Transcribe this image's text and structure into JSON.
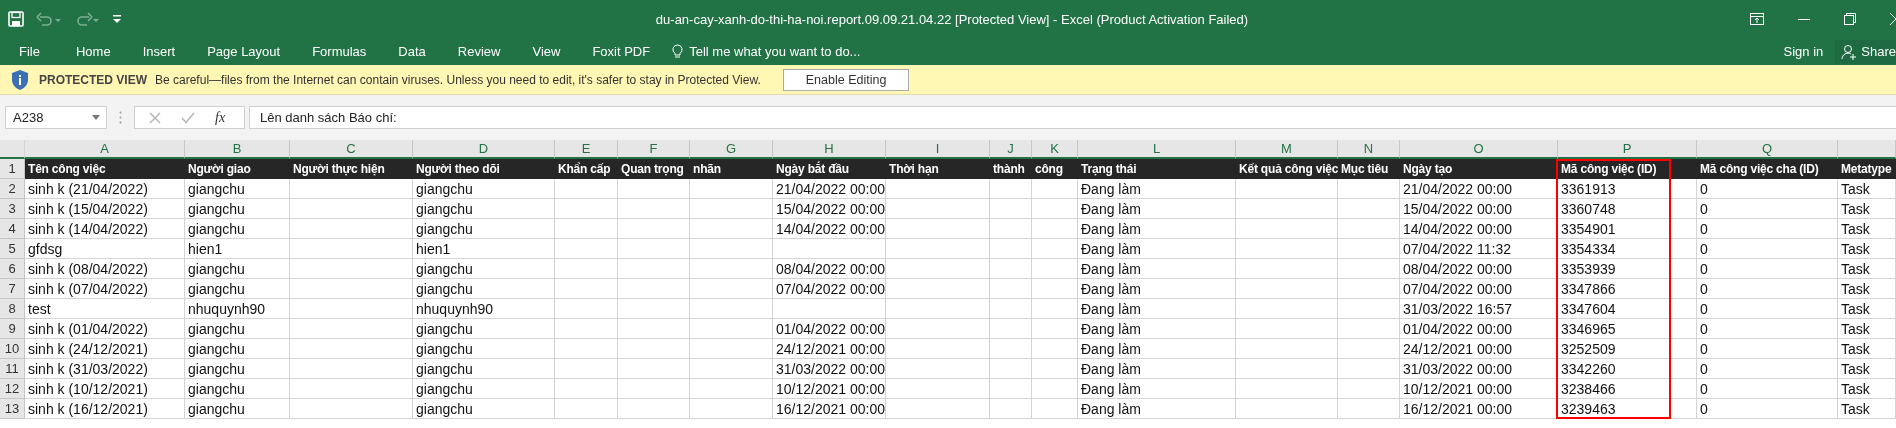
{
  "window": {
    "title": "du-an-cay-xanh-do-thi-ha-noi.report.09.09.21.04.22  [Protected View] - Excel (Product Activation Failed)",
    "quick_access": [
      {
        "kind": "save"
      },
      {
        "kind": "undo",
        "disabled": true
      },
      {
        "kind": "redo",
        "disabled": true
      },
      {
        "kind": "customize"
      }
    ],
    "controls": [
      {
        "kind": "ribbon-display"
      },
      {
        "kind": "minimize"
      },
      {
        "kind": "restore"
      },
      {
        "kind": "close"
      }
    ]
  },
  "ribbon": {
    "tabs": [
      {
        "label": "File"
      },
      {
        "label": "Home"
      },
      {
        "label": "Insert"
      },
      {
        "label": "Page Layout"
      },
      {
        "label": "Formulas"
      },
      {
        "label": "Data"
      },
      {
        "label": "Review"
      },
      {
        "label": "View"
      },
      {
        "label": "Foxit PDF"
      }
    ],
    "tell_me": "Tell me what you want to do...",
    "sign_in": "Sign in",
    "share": "Share"
  },
  "message_bar": {
    "title": "PROTECTED VIEW",
    "text": "Be careful—files from the Internet can contain viruses. Unless you need to edit, it's safer to stay in Protected View.",
    "button": "Enable Editing"
  },
  "formula_bar": {
    "name_box": "A238",
    "fx": "fx",
    "value": "Lên danh sách Báo chí:"
  },
  "sheet": {
    "columns": [
      {
        "letter": "A",
        "header": "Tên công việc",
        "highlighted": false
      },
      {
        "letter": "B",
        "header": "Người giao",
        "highlighted": false
      },
      {
        "letter": "C",
        "header": "Người thực hiện",
        "highlighted": false
      },
      {
        "letter": "D",
        "header": "Người theo dõi",
        "highlighted": false
      },
      {
        "letter": "E",
        "header": "Khẩn cấp",
        "highlighted": false
      },
      {
        "letter": "F",
        "header": "Quan trọng",
        "highlighted": false
      },
      {
        "letter": "G",
        "header": "nhãn",
        "highlighted": false
      },
      {
        "letter": "H",
        "header": "Ngày bắt đầu",
        "highlighted": false
      },
      {
        "letter": "I",
        "header": "Thời hạn",
        "highlighted": false
      },
      {
        "letter": "J",
        "header": "thành",
        "highlighted": false
      },
      {
        "letter": "K",
        "header": "công",
        "highlighted": false
      },
      {
        "letter": "L",
        "header": "Trạng thái",
        "highlighted": false
      },
      {
        "letter": "M",
        "header": "Kết quả công việc",
        "highlighted": false
      },
      {
        "letter": "N",
        "header": "Mục tiêu",
        "highlighted": false
      },
      {
        "letter": "O",
        "header": "Ngày tạo",
        "highlighted": false
      },
      {
        "letter": "P",
        "header": "Mã công việc (ID)",
        "highlighted": true
      },
      {
        "letter": "Q",
        "header": "Mã công việc cha (ID)",
        "highlighted": false
      },
      {
        "header": "Metatype",
        "highlighted": false
      }
    ],
    "header_row_number": "1",
    "rows": [
      {
        "number": "2",
        "cells": [
          "sinh k (21/04/2022)",
          "giangchu",
          null,
          "giangchu",
          null,
          null,
          null,
          "21/04/2022 00:00",
          null,
          null,
          null,
          "Đang làm",
          null,
          null,
          "21/04/2022 00:00",
          "3361913",
          "0",
          "Task"
        ]
      },
      {
        "number": "3",
        "cells": [
          "sinh k (15/04/2022)",
          "giangchu",
          null,
          "giangchu",
          null,
          null,
          null,
          "15/04/2022 00:00",
          null,
          null,
          null,
          "Đang làm",
          null,
          null,
          "15/04/2022 00:00",
          "3360748",
          "0",
          "Task"
        ]
      },
      {
        "number": "4",
        "cells": [
          "sinh k (14/04/2022)",
          "giangchu",
          null,
          "giangchu",
          null,
          null,
          null,
          "14/04/2022 00:00",
          null,
          null,
          null,
          "Đang làm",
          null,
          null,
          "14/04/2022 00:00",
          "3354901",
          "0",
          "Task"
        ]
      },
      {
        "number": "5",
        "cells": [
          "gfdsg",
          "hien1",
          null,
          "hien1",
          null,
          null,
          null,
          null,
          null,
          null,
          null,
          "Đang làm",
          null,
          null,
          "07/04/2022 11:32",
          "3354334",
          "0",
          "Task"
        ]
      },
      {
        "number": "6",
        "cells": [
          "sinh k (08/04/2022)",
          "giangchu",
          null,
          "giangchu",
          null,
          null,
          null,
          "08/04/2022 00:00",
          null,
          null,
          null,
          "Đang làm",
          null,
          null,
          "08/04/2022 00:00",
          "3353939",
          "0",
          "Task"
        ]
      },
      {
        "number": "7",
        "cells": [
          "sinh k (07/04/2022)",
          "giangchu",
          null,
          "giangchu",
          null,
          null,
          null,
          "07/04/2022 00:00",
          null,
          null,
          null,
          "Đang làm",
          null,
          null,
          "07/04/2022 00:00",
          "3347866",
          "0",
          "Task"
        ]
      },
      {
        "number": "8",
        "cells": [
          "test",
          "nhuquynh90",
          null,
          "nhuquynh90",
          null,
          null,
          null,
          null,
          null,
          null,
          null,
          "Đang làm",
          null,
          null,
          "31/03/2022 16:57",
          "3347604",
          "0",
          "Task"
        ]
      },
      {
        "number": "9",
        "cells": [
          "sinh k (01/04/2022)",
          "giangchu",
          null,
          "giangchu",
          null,
          null,
          null,
          "01/04/2022 00:00",
          null,
          null,
          null,
          "Đang làm",
          null,
          null,
          "01/04/2022 00:00",
          "3346965",
          "0",
          "Task"
        ]
      },
      {
        "number": "10",
        "cells": [
          "sinh k (24/12/2021)",
          "giangchu",
          null,
          "giangchu",
          null,
          null,
          null,
          "24/12/2021 00:00",
          null,
          null,
          null,
          "Đang làm",
          null,
          null,
          "24/12/2021 00:00",
          "3252509",
          "0",
          "Task"
        ]
      },
      {
        "number": "11",
        "cells": [
          "sinh k (31/03/2022)",
          "giangchu",
          null,
          "giangchu",
          null,
          null,
          null,
          "31/03/2022 00:00",
          null,
          null,
          null,
          "Đang làm",
          null,
          null,
          "31/03/2022 00:00",
          "3342260",
          "0",
          "Task"
        ]
      },
      {
        "number": "12",
        "cells": [
          "sinh k (10/12/2021)",
          "giangchu",
          null,
          "giangchu",
          null,
          null,
          null,
          "10/12/2021 00:00",
          null,
          null,
          null,
          "Đang làm",
          null,
          null,
          "10/12/2021 00:00",
          "3238466",
          "0",
          "Task"
        ]
      },
      {
        "number": "13",
        "cells": [
          "sinh k (16/12/2021)",
          "giangchu",
          null,
          "giangchu",
          null,
          null,
          null,
          "16/12/2021 00:00",
          null,
          null,
          null,
          "Đang làm",
          null,
          null,
          "16/12/2021 00:00",
          "3239463",
          "0",
          "Task"
        ]
      }
    ]
  }
}
